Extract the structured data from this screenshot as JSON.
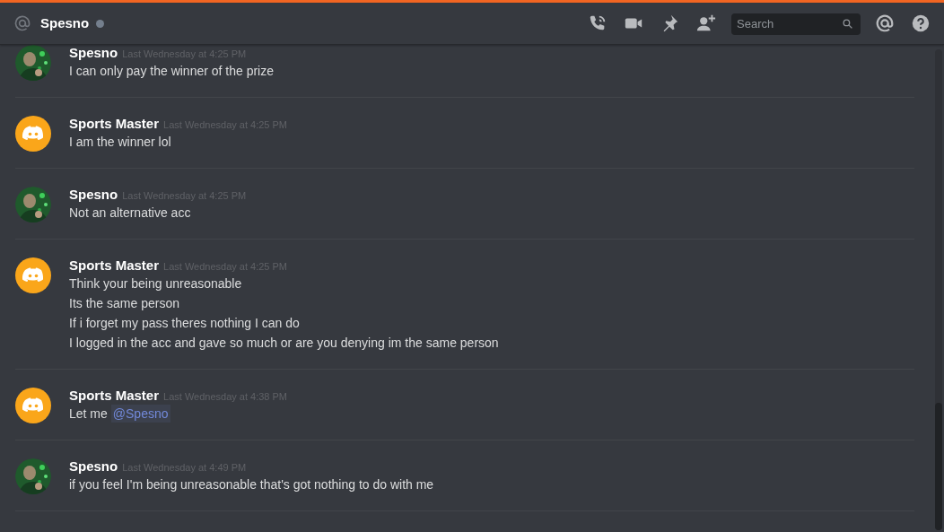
{
  "header": {
    "channel": "Spesno",
    "search": {
      "placeholder": "Search"
    }
  },
  "messages": [
    {
      "author": "Spesno",
      "time": "Last Wednesday at 4:25 PM",
      "lines": [
        {
          "text": "I can only pay the winner of the prize"
        }
      ]
    },
    {
      "author": "Sports Master",
      "avatar": {
        "kind": "logo"
      },
      "time": "Last Wednesday at 4:25 PM",
      "lines": [
        {
          "text": "I am the winner lol"
        }
      ]
    },
    {
      "author": "Spesno",
      "time": "Last Wednesday at 4:25 PM",
      "lines": [
        {
          "text": "Not an alternative acc"
        }
      ]
    },
    {
      "author": "Sports Master",
      "avatar": {
        "kind": "logo"
      },
      "time": "Last Wednesday at 4:25 PM",
      "lines": [
        {
          "text": "Think your being unreasonable"
        },
        {
          "text": "Its the same person"
        },
        {
          "text": "If i forget my pass theres nothing I can do"
        },
        {
          "text": "I logged in the acc and gave so much or are you denying im the same person"
        }
      ]
    },
    {
      "author": "Sports Master",
      "avatar": {
        "kind": "logo"
      },
      "time": "Last Wednesday at 4:38 PM",
      "lines": [
        {
          "text": "Let me",
          "mention": "@Spesno"
        }
      ]
    },
    {
      "author": "Spesno",
      "time": "Last Wednesday at 4:49 PM",
      "lines": [
        {
          "text": "if you feel I'm being unreasonable that's got nothing to do with me"
        }
      ]
    }
  ]
}
